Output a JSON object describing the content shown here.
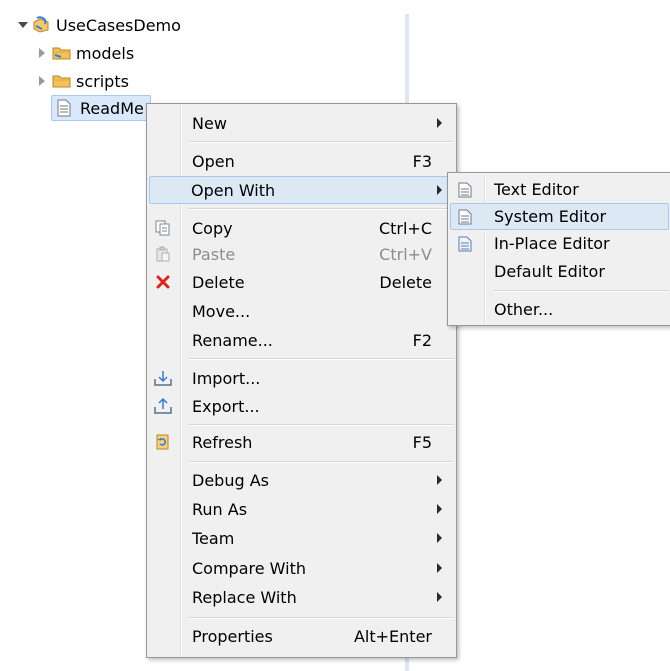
{
  "tree": {
    "project": "UseCasesDemo",
    "folders": [
      "models",
      "scripts"
    ],
    "file": "ReadMe"
  },
  "context_menu": {
    "items": [
      {
        "label": "New",
        "submenu": true
      },
      {
        "label": "Open",
        "shortcut": "F3"
      },
      {
        "label": "Open With",
        "submenu": true
      },
      {
        "label": "Copy",
        "shortcut": "Ctrl+C"
      },
      {
        "label": "Paste",
        "shortcut": "Ctrl+V"
      },
      {
        "label": "Delete",
        "shortcut": "Delete"
      },
      {
        "label": "Move..."
      },
      {
        "label": "Rename...",
        "shortcut": "F2"
      },
      {
        "label": "Import..."
      },
      {
        "label": "Export..."
      },
      {
        "label": "Refresh",
        "shortcut": "F5"
      },
      {
        "label": "Debug As",
        "submenu": true
      },
      {
        "label": "Run As",
        "submenu": true
      },
      {
        "label": "Team",
        "submenu": true
      },
      {
        "label": "Compare With",
        "submenu": true
      },
      {
        "label": "Replace With",
        "submenu": true
      },
      {
        "label": "Properties",
        "shortcut": "Alt+Enter"
      }
    ]
  },
  "open_with_submenu": {
    "items": [
      {
        "label": "Text Editor"
      },
      {
        "label": "System Editor"
      },
      {
        "label": "In-Place Editor"
      },
      {
        "label": "Default Editor"
      },
      {
        "label": "Other..."
      }
    ]
  },
  "icons": {
    "project": "project-icon",
    "folder": "folder-icon",
    "file": "text-file-icon",
    "copy": "copy-icon",
    "paste": "paste-icon",
    "delete": "delete-x-icon",
    "import": "import-icon",
    "export": "export-icon",
    "refresh": "refresh-icon",
    "editor": "editor-icon"
  },
  "colors": {
    "menu_bg": "#f0f0f0",
    "hover_bg": "#dde8f5",
    "hover_border": "#a8c8ee",
    "delete_red": "#d9261c",
    "folder_orange": "#e8a33b"
  }
}
